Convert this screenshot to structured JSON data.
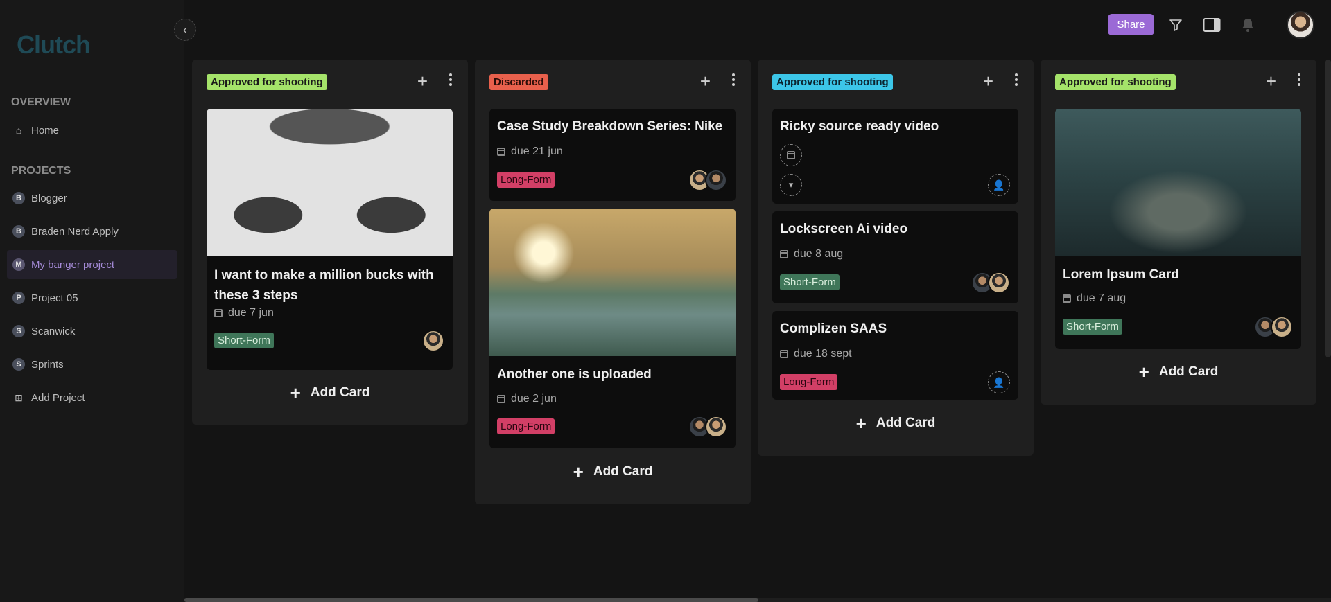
{
  "app": {
    "logo_text": "Clutch"
  },
  "sidebar": {
    "overview_title": "OVERVIEW",
    "home_label": "Home",
    "projects_title": "PROJECTS",
    "projects": [
      {
        "letter": "B",
        "label": "Blogger"
      },
      {
        "letter": "B",
        "label": "Braden Nerd Apply"
      },
      {
        "letter": "M",
        "label": "My banger project"
      },
      {
        "letter": "P",
        "label": "Project 05"
      },
      {
        "letter": "S",
        "label": "Scanwick"
      },
      {
        "letter": "S",
        "label": "Sprints"
      }
    ],
    "add_project_label": "Add Project"
  },
  "topbar": {
    "share_label": "Share",
    "icons": [
      "filter-icon",
      "sidebar-toggle-icon",
      "bell-icon",
      "user-avatar"
    ]
  },
  "columns": [
    {
      "status": "Approved for shooting",
      "cards": [
        {
          "title_line1": "I want to make a million bucks with",
          "title_line2": "these 3 steps",
          "due": "due 7 jun",
          "tag": "Short-Form"
        }
      ],
      "add_label": "Add Card"
    },
    {
      "status": "Discarded",
      "cards": [
        {
          "title": "Case Study Breakdown Series: Nike",
          "due": "due 21 jun",
          "tag": "Long-Form"
        },
        {
          "title": "Another one is uploaded",
          "due": "due 2 jun",
          "tag": "Long-Form"
        }
      ],
      "add_label": "Add Card"
    },
    {
      "status": "Approved for shooting",
      "cards": [
        {
          "title": "Ricky source ready video"
        },
        {
          "title": "Lockscreen Ai video",
          "due": "due 8 aug",
          "tag": "Short-Form"
        },
        {
          "title": "Complizen SAAS",
          "due": "due 18 sept",
          "tag": "Long-Form"
        }
      ],
      "add_label": "Add Card"
    },
    {
      "status": "Approved for shooting",
      "cards": [
        {
          "title": "Lorem Ipsum Card",
          "due": "due 7 aug",
          "tag": "Short-Form"
        }
      ],
      "add_label": "Add Card"
    }
  ],
  "colors": {
    "accent": "#9b6ad6",
    "status_green": "#a5e36a",
    "status_red": "#e8604c",
    "status_cyan": "#3cc6e8",
    "tag_short": "#3f7659",
    "tag_long": "#d23f66"
  }
}
